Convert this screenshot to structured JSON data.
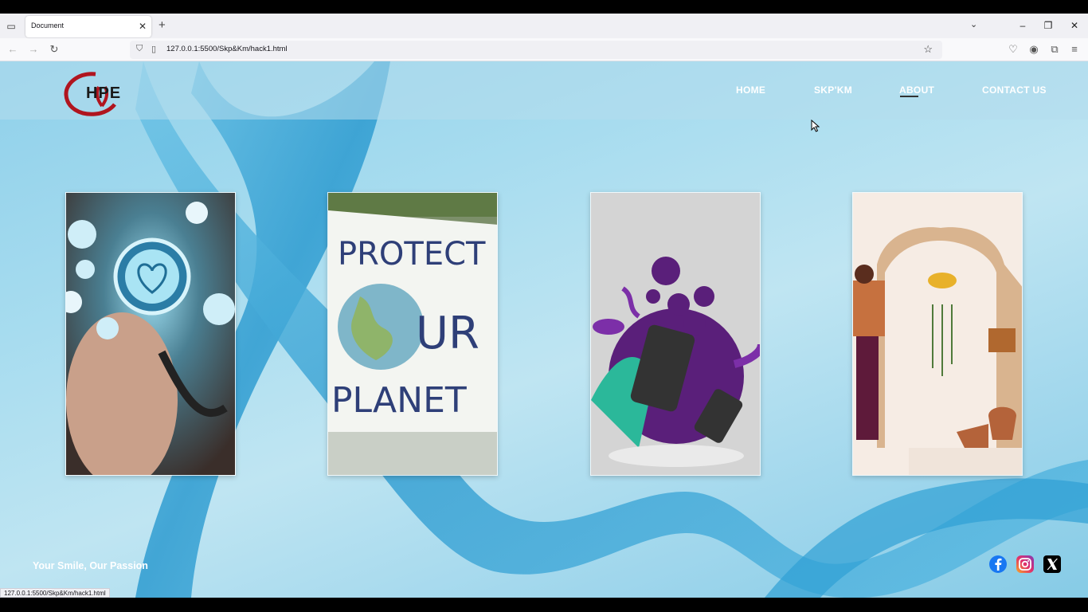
{
  "browser": {
    "tab_title": "Document",
    "tab_close": "✕",
    "new_tab": "+",
    "url": "127.0.0.1:5500/Skp&Km/hack1.html",
    "status_url": "127.0.0.1:5500/Skp&Km/hack1.html",
    "icons": [
      "tab-list-icon",
      "back-icon",
      "forward-icon",
      "reload-icon",
      "shield-icon",
      "page-icon",
      "star-icon",
      "pocket-icon",
      "account-icon",
      "extensions-icon",
      "menu-icon",
      "minimize-icon",
      "restore-icon",
      "close-icon",
      "chevron-down-icon"
    ]
  },
  "site": {
    "logo_text": "HPE",
    "nav": [
      {
        "label": "HOME"
      },
      {
        "label": "SKP'KM"
      },
      {
        "label": "ABOUT",
        "active": true
      },
      {
        "label": "CONTACT US"
      }
    ],
    "cards": [
      {
        "name": "health-card",
        "caption": ""
      },
      {
        "name": "planet-card",
        "caption": "PROTECT OUR PLANET"
      },
      {
        "name": "social-card",
        "caption": ""
      },
      {
        "name": "plants-card",
        "caption": ""
      }
    ],
    "planet_card_lines": [
      "PROTECT",
      "UR",
      "PLANET"
    ],
    "tagline": "Your Smile, Our Passion",
    "social_icons": [
      "facebook-icon",
      "instagram-icon",
      "x-icon"
    ],
    "colors": {
      "accent_red": "#b0151f",
      "sky": "#a7dcef",
      "ribbon": "#3aa7d6"
    }
  }
}
